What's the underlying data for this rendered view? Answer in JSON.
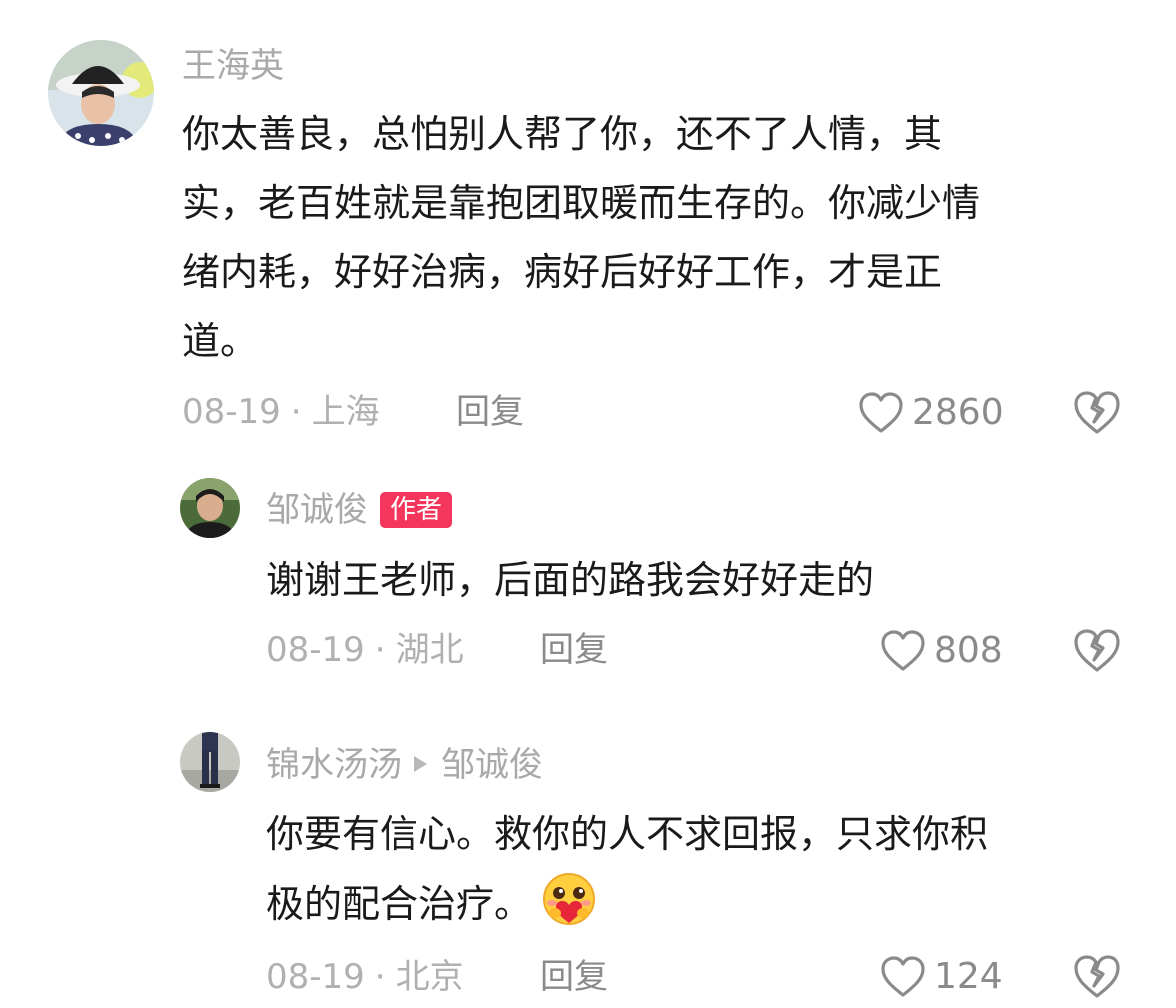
{
  "comments": [
    {
      "username": "王海英",
      "lines": [
        "你太善良，总怕别人帮了你，还不了人情，其",
        "实，老百姓就是靠抱团取暖而生存的。你减少情",
        "绪内耗，好好治病，病好后好好工作，才是正",
        "道。"
      ],
      "date": "08-19",
      "location": "上海",
      "reply_label": "回复",
      "likes": "2860"
    },
    {
      "username": "邹诚俊",
      "badge": "作者",
      "lines": [
        "谢谢王老师，后面的路我会好好走的"
      ],
      "date": "08-19",
      "location": "湖北",
      "reply_label": "回复",
      "likes": "808"
    },
    {
      "username": "锦水汤汤",
      "reply_to": "邹诚俊",
      "lines": [
        "你要有信心。救你的人不求回报，只求你积",
        "极的配合治疗。"
      ],
      "emoji": "hug-heart-emoji",
      "date": "08-19",
      "location": "北京",
      "reply_label": "回复",
      "likes": "124"
    }
  ],
  "icons": {
    "like": "heart-outline-icon",
    "dislike": "broken-heart-icon"
  },
  "colors": {
    "badge": "#f5365c",
    "username": "#a9a9a9",
    "meta": "#b0b0b0",
    "icon": "#8a8a8a"
  }
}
